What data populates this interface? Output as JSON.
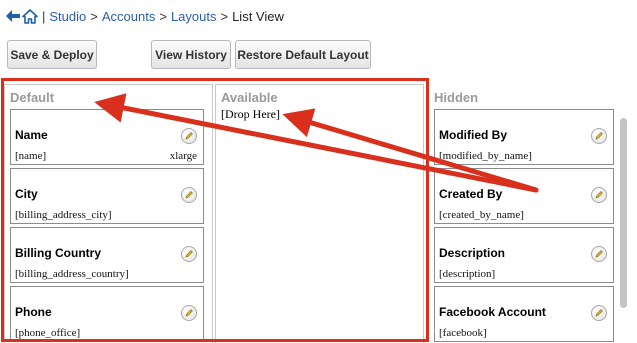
{
  "header": {
    "back_icon": "back-arrow-icon",
    "home_icon": "home-icon",
    "separator": "|",
    "breadcrumbs": [
      {
        "label": "Studio",
        "link": true
      },
      {
        "label": "Accounts",
        "link": true
      },
      {
        "label": "Layouts",
        "link": true
      },
      {
        "label": "List View",
        "link": false
      }
    ],
    "crumb_separator": ">"
  },
  "toolbar": {
    "save_deploy": "Save & Deploy",
    "view_history": "View History",
    "restore_default": "Restore Default Layout"
  },
  "columns": {
    "default": {
      "title": "Default",
      "fields": [
        {
          "label": "Name",
          "key": "[name]",
          "size": "xlarge"
        },
        {
          "label": "City",
          "key": "[billing_address_city]",
          "size": ""
        },
        {
          "label": "Billing Country",
          "key": "[billing_address_country]",
          "size": ""
        },
        {
          "label": "Phone",
          "key": "[phone_office]",
          "size": ""
        }
      ]
    },
    "available": {
      "title": "Available",
      "drop_text": "[Drop Here]"
    },
    "hidden": {
      "title": "Hidden",
      "fields": [
        {
          "label": "Modified By",
          "key": "[modified_by_name]"
        },
        {
          "label": "Created By",
          "key": "[created_by_name]"
        },
        {
          "label": "Description",
          "key": "[description]"
        },
        {
          "label": "Facebook Account",
          "key": "[facebook]"
        }
      ]
    }
  },
  "annotation": {
    "color": "#d9301d",
    "highlight": "default-and-available-columns"
  },
  "colors": {
    "link": "#2a5db0",
    "column_title": "#9a9a9a",
    "card_border": "#8c8c8c"
  }
}
